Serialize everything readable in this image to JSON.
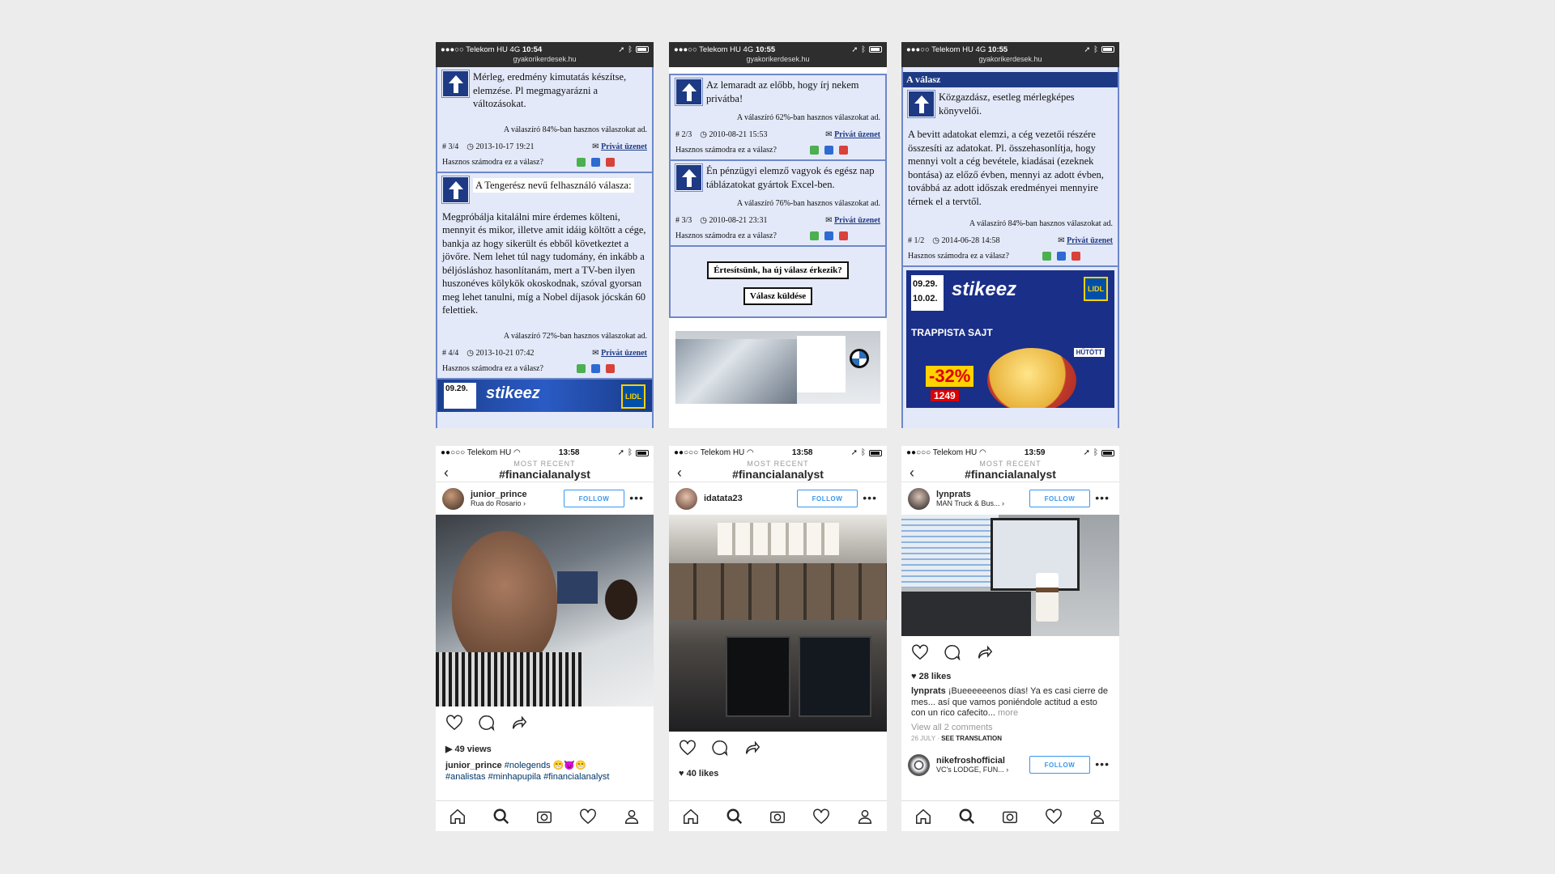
{
  "forum": {
    "carrier": "●●●○○ Telekom HU",
    "network": "4G",
    "url": "gyakorikerdesek.hu",
    "p1": {
      "time": "10:54",
      "a1_text": "Mérleg, eredmény kimutatás készítse, elemzése. Pl megmagyarázni a változásokat.",
      "a1_meta": "A válaszíró 84%-ban hasznos válaszokat ad.",
      "a1_num": "# 3/4",
      "a1_date": "2013-10-17 19:21",
      "pm": "Privát üzenet",
      "helpful": "Hasznos számodra ez a válasz?",
      "a2_name": "A Tengerész nevű felhasználó válasza:",
      "a2_text": "Megpróbálja kitalálni mire érdemes költeni, mennyit és mikor, illetve amit idáig költött a cége, bankja az hogy sikerült és ebből következtet a jövőre. Nem lehet túl nagy tudomány, én inkább a béljósláshoz hasonlítanám, mert a TV-ben ilyen huszonéves kölykök okoskodnak, szóval gyorsan meg lehet tanulni, míg a Nobel díjasok jócskán 60 felettiek.",
      "a2_meta": "A válaszíró 72%-ban hasznos válaszokat ad.",
      "a2_num": "# 4/4",
      "a2_date": "2013-10-21 07:42",
      "ad_date": "09.29.",
      "ad_brand": "stikeez",
      "ad_lidl": "LIDL"
    },
    "p2": {
      "time": "10:55",
      "a1_text": "Az lemaradt az előbb, hogy írj nekem privátba!",
      "a1_meta": "A válaszíró 62%-ban hasznos válaszokat ad.",
      "a1_num": "# 2/3",
      "a1_date": "2010-08-21 15:53",
      "a2_text": "Én pénzügyi elemző vagyok és egész nap táblázatokat gyártok Excel-ben.",
      "a2_meta": "A válaszíró 76%-ban hasznos válaszokat ad.",
      "a2_num": "# 3/3",
      "a2_date": "2010-08-21 23:31",
      "btn_notify": "Értesítsünk, ha új válasz érkezik?",
      "btn_send": "Válasz küldése"
    },
    "p3": {
      "time": "10:55",
      "header": "A válasz",
      "a1_role": "Közgazdász, esetleg mérlegképes könyvelői.",
      "a1_text": "A bevitt adatokat elemzi, a cég vezetői részére összesíti az adatokat. Pl. összehasonlítja, hogy mennyi volt a cég bevétele, kiadásai (ezeknek bontása) az előző évben, mennyi az adott évben, továbbá az adott időszak eredményei mennyire térnek el a tervtől.",
      "a1_meta": "A válaszíró 84%-ban hasznos válaszokat ad.",
      "a1_num": "# 1/2",
      "a1_date": "2014-06-28 14:58",
      "ad_date1": "09.29.",
      "ad_date2": "10.02.",
      "ad_brand": "stikeez",
      "ad_lidl": "LIDL",
      "ad_product": "TRAPPISTA SAJT",
      "ad_cool": "HŰTÖTT",
      "ad_discount": "-32%",
      "ad_price": "1249"
    }
  },
  "insta": {
    "carrier": "●●○○○ Telekom HU",
    "most_recent": "MOST RECENT",
    "hashtag": "#financialanalyst",
    "follow": "FOLLOW",
    "p1": {
      "time": "13:58",
      "user": "junior_prince",
      "location": "Rua do Rosario ›",
      "views": "49 views",
      "cap_user": "junior_prince",
      "cap_text": "#nolegends 😁😈😁",
      "cap_tags": "#analistas #minhapupila #financialanalyst"
    },
    "p2": {
      "time": "13:58",
      "user": "idatata23",
      "likes": "40 likes"
    },
    "p3": {
      "time": "13:59",
      "user": "lynprats",
      "location": "MAN Truck & Bus... ›",
      "likes": "28 likes",
      "cap_user": "lynprats",
      "cap_text": "¡Bueeeeeenos días! Ya es casi cierre de mes... así que vamos poniéndole actitud a esto con un rico cafecito...",
      "more": "more",
      "comments": "View all 2 comments",
      "date": "26 JULY",
      "translate": "SEE TRANSLATION",
      "user2": "nikefroshofficial",
      "location2": "VC's LODGE, FUN... ›"
    }
  },
  "colors": {
    "forum_bg": "#e4e9f9",
    "forum_accent": "#1e3a84",
    "insta_blue": "#3897f0"
  }
}
